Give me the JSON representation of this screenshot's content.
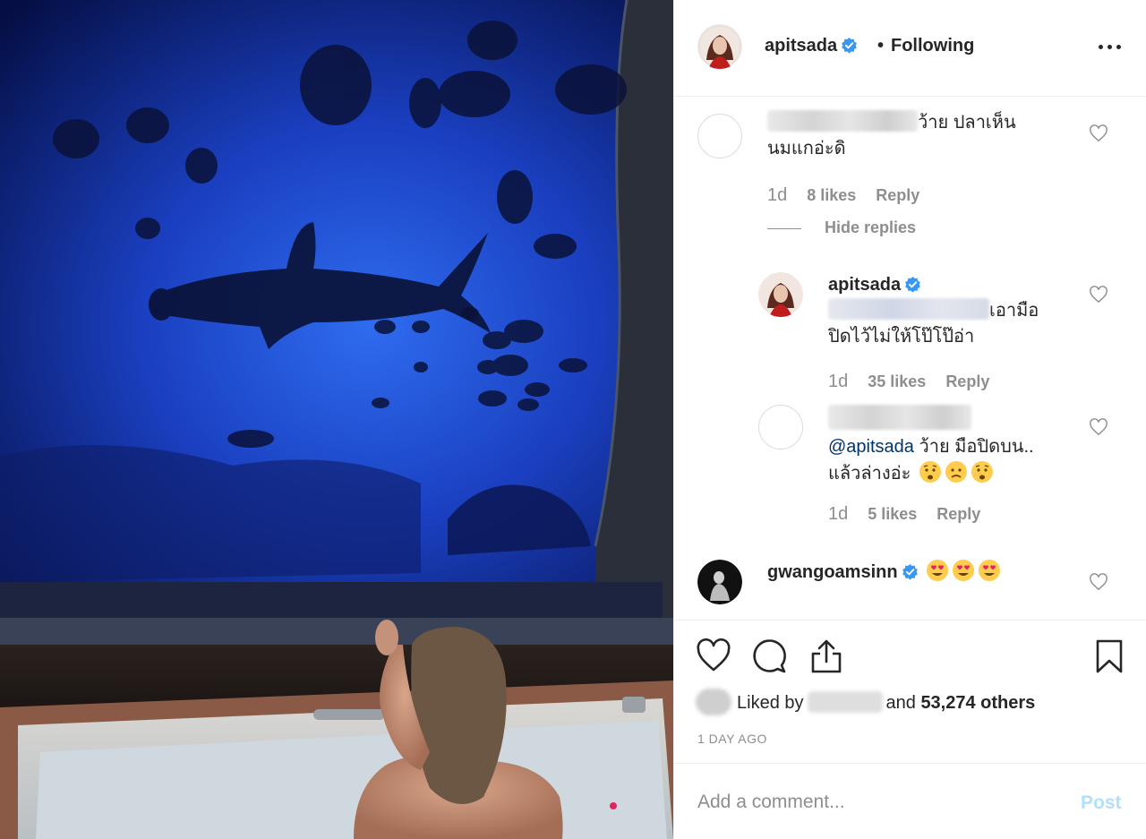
{
  "post": {
    "author": "apitsada",
    "separator": "•",
    "follow_status": "Following"
  },
  "comments": [
    {
      "username_hidden": true,
      "text_line1": "ว้าย ปลาเห็น",
      "text_line2": "นมแกอ่ะดิ",
      "time": "1d",
      "likes": "8 likes",
      "reply_label": "Reply",
      "hide_replies_label": "Hide replies",
      "replies": [
        {
          "username": "apitsada",
          "verified": true,
          "text_line1": "เอามือ",
          "text_line2": "ปิดไว้ไม่ให้โป๊โป๊อ่า",
          "time": "1d",
          "likes": "35 likes",
          "reply_label": "Reply"
        },
        {
          "username_hidden": true,
          "mention": "@apitsada",
          "text_line1": "ว้าย มือปิดบน..",
          "text_line2": "แล้วล่างอ่ะ",
          "emojis": [
            "anxious-face",
            "frowning-face",
            "anxious-face"
          ],
          "time": "1d",
          "likes": "5 likes",
          "reply_label": "Reply"
        }
      ]
    },
    {
      "username": "gwangoamsinn",
      "verified": true,
      "emojis": [
        "heart-eyes-face",
        "heart-eyes-face",
        "heart-eyes-face"
      ]
    }
  ],
  "actions": {
    "liked_prefix": "Liked by",
    "liked_and": "and",
    "liked_count": "53,274 others",
    "date": "1 DAY AGO"
  },
  "composer": {
    "placeholder": "Add a comment...",
    "post_label": "Post"
  },
  "colors": {
    "text": "#262626",
    "secondary": "#8e8e8e",
    "verified": "#3897f0",
    "post_disabled": "#b2dffc",
    "mention": "#003569"
  }
}
